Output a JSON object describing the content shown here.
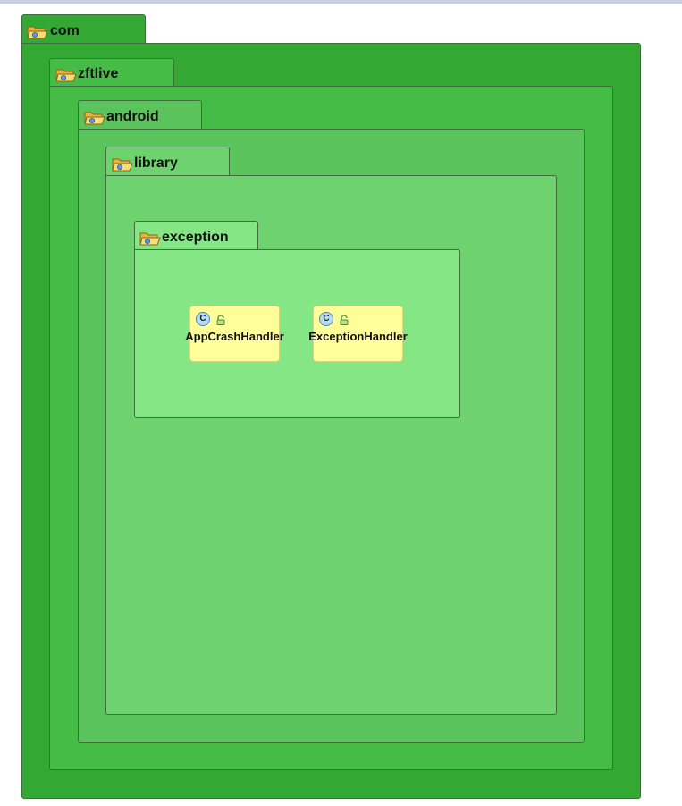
{
  "packages": {
    "com": "com",
    "zftlive": "zftlive",
    "android": "android",
    "library": "library",
    "exception": "exception"
  },
  "classes": [
    {
      "name": "AppCrashHandler",
      "icon_letter": "C"
    },
    {
      "name": "ExceptionHandler",
      "icon_letter": "C"
    }
  ],
  "colors": {
    "level1": "#33a833",
    "level2": "#45bc45",
    "level3": "#5bc35b",
    "level4": "#6ed26e",
    "level5": "#85e685",
    "class_fill": "#ffff99"
  },
  "icons": [
    "folder-package-icon",
    "class-icon",
    "lock-icon"
  ]
}
